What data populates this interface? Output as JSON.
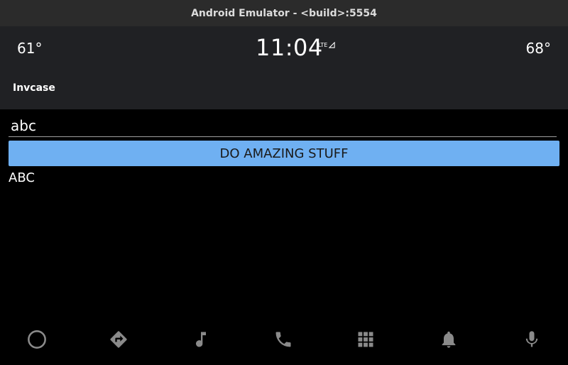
{
  "window": {
    "title": "Android Emulator - <build>:5554"
  },
  "status": {
    "temp_left": "61°",
    "time": "11:04",
    "network": "LTE",
    "temp_right": "68°"
  },
  "app": {
    "title": "Invcase"
  },
  "main": {
    "input_value": "abc",
    "button_label": "DO AMAZING STUFF",
    "output_text": "ABC"
  },
  "nav": {
    "items": [
      "home-icon",
      "navigation-icon",
      "music-icon",
      "phone-icon",
      "app-grid-icon",
      "notification-bell-icon",
      "microphone-icon"
    ]
  },
  "colors": {
    "button_bg": "#6fb0f2",
    "status_bg": "#202124",
    "nav_icon": "#8a8a8a"
  }
}
